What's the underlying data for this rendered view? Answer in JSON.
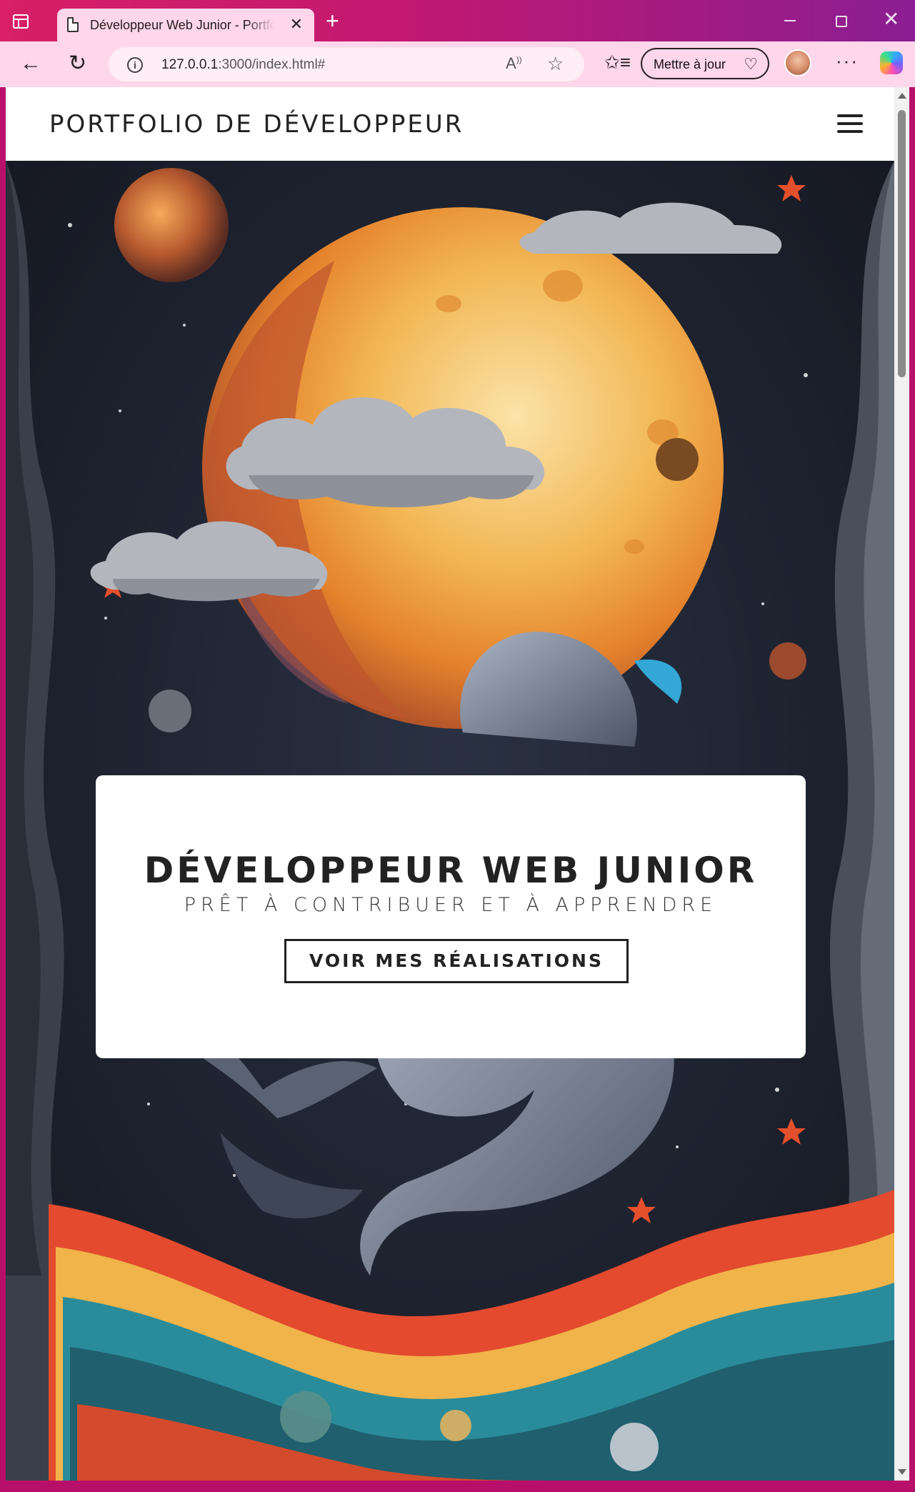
{
  "browser": {
    "tab_title": "Développeur Web Junior - Portfolio",
    "tab_close": "✕",
    "new_tab": "+",
    "url_host": "127.0.0.1",
    "url_rest": ":3000/index.html#",
    "update_label": "Mettre à jour",
    "read_aloud": "Aʹ→",
    "icons": {
      "back": "back-arrow-icon",
      "reload": "reload-icon",
      "favorite": "star-icon",
      "collections": "favorites-icon",
      "more": "more-icon",
      "copilot": "copilot-icon"
    }
  },
  "site": {
    "logo": "PORTFOLIO DE DÉVELOPPEUR",
    "menu_icon": "hamburger-icon"
  },
  "hero": {
    "title": "DÉVELOPPEUR WEB JUNIOR",
    "subtitle": "PRÊT À CONTRIBUER ET À APPRENDRE",
    "cta": "VOIR MES RÉALISATIONS"
  },
  "colors": {
    "chrome_gradient_start": "#d81f67",
    "chrome_gradient_end": "#8a1e92",
    "toolbar_bg": "#ffd6ea",
    "page_text": "#222222"
  }
}
